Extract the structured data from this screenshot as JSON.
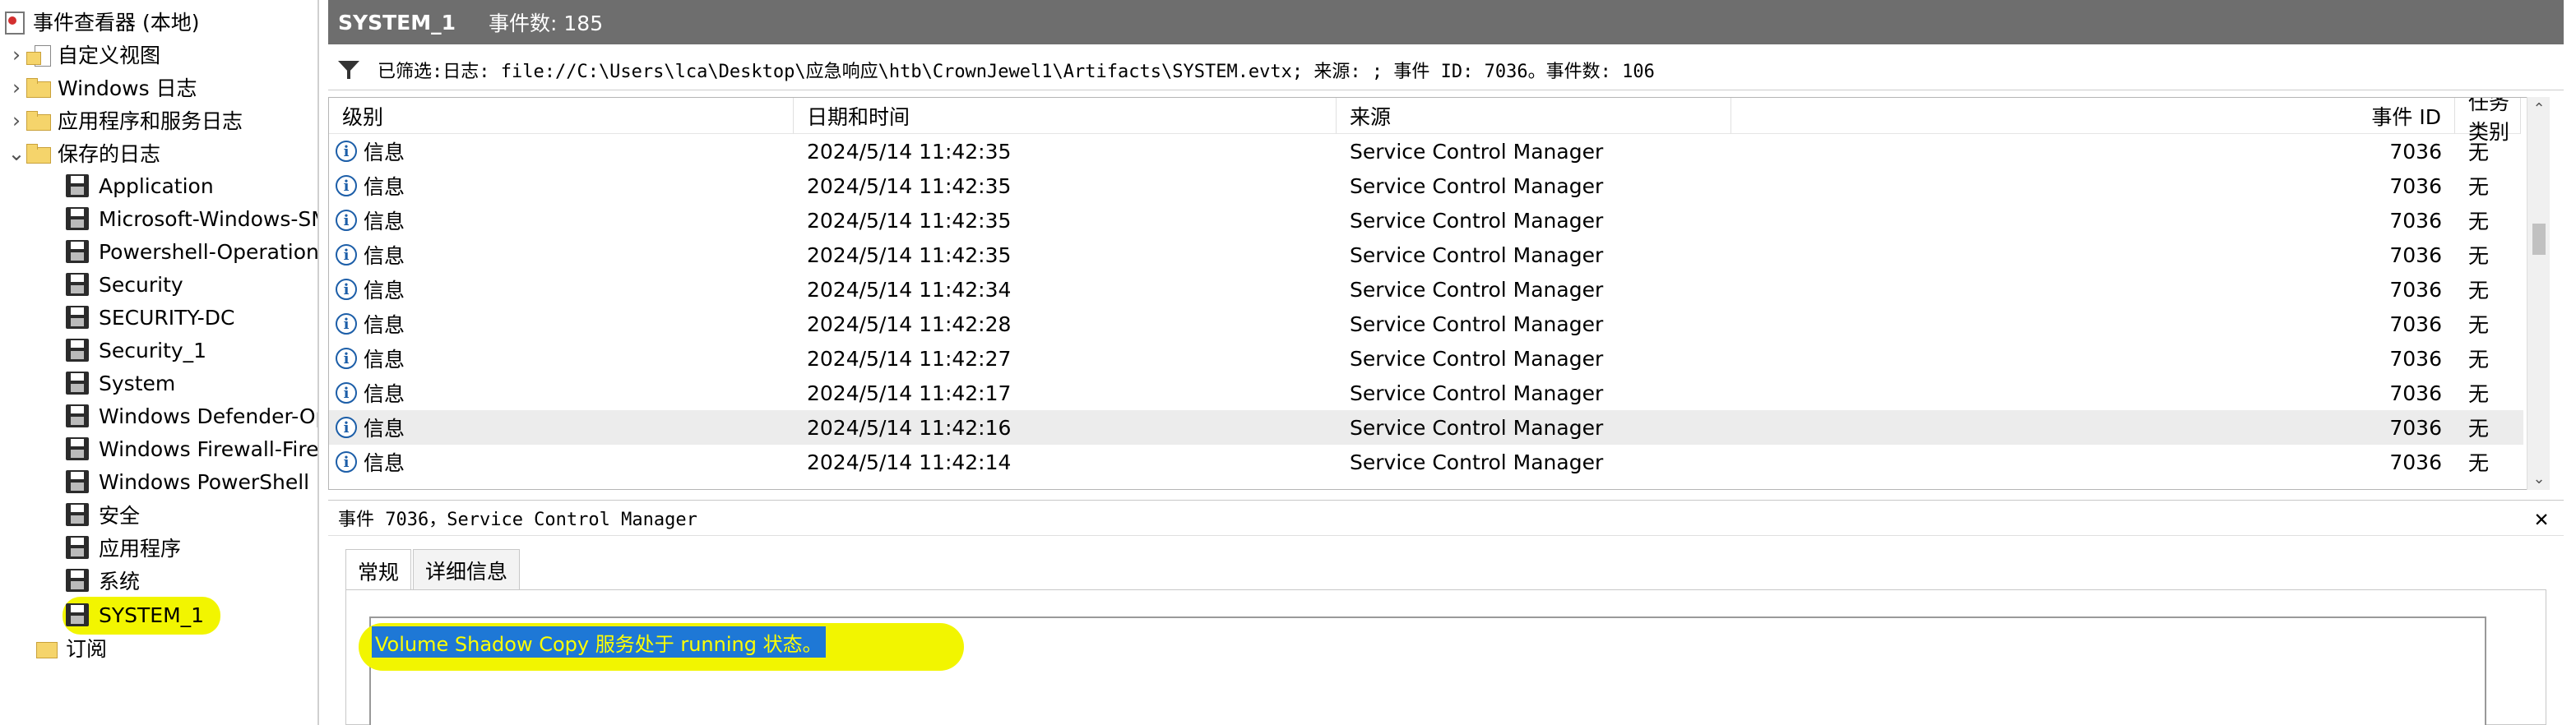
{
  "tree": {
    "root_label": "事件查看器 (本地)",
    "items": [
      {
        "label": "自定义视图",
        "kind": "folder"
      },
      {
        "label": "Windows 日志",
        "kind": "folder"
      },
      {
        "label": "应用程序和服务日志",
        "kind": "folder"
      },
      {
        "label": "保存的日志",
        "kind": "folder-open"
      }
    ],
    "saved_logs": [
      "Application",
      "Microsoft-Windows-SMBServer",
      "Powershell-Operational",
      "Security",
      "SECURITY-DC",
      "Security_1",
      "System",
      "Windows Defender-Operational",
      "Windows Firewall-Firewall",
      "Windows PowerShell",
      "安全",
      "应用程序",
      "系统",
      "SYSTEM_1"
    ],
    "subscriptions_label": "订阅",
    "selected": "SYSTEM_1"
  },
  "header": {
    "log_name": "SYSTEM_1",
    "event_count": "事件数: 185"
  },
  "filter": {
    "text": "已筛选:日志: file://C:\\Users\\lca\\Desktop\\应急响应\\htb\\CrownJewel1\\Artifacts\\SYSTEM.evtx; 来源: ; 事件 ID: 7036。事件数: 106"
  },
  "grid": {
    "columns": [
      "级别",
      "日期和时间",
      "来源",
      "事件 ID",
      "任务类别"
    ],
    "rows": [
      {
        "level": "信息",
        "datetime": "2024/5/14 11:42:35",
        "source": "Service Control Manager",
        "event_id": "7036",
        "task": "无"
      },
      {
        "level": "信息",
        "datetime": "2024/5/14 11:42:35",
        "source": "Service Control Manager",
        "event_id": "7036",
        "task": "无"
      },
      {
        "level": "信息",
        "datetime": "2024/5/14 11:42:35",
        "source": "Service Control Manager",
        "event_id": "7036",
        "task": "无"
      },
      {
        "level": "信息",
        "datetime": "2024/5/14 11:42:35",
        "source": "Service Control Manager",
        "event_id": "7036",
        "task": "无"
      },
      {
        "level": "信息",
        "datetime": "2024/5/14 11:42:34",
        "source": "Service Control Manager",
        "event_id": "7036",
        "task": "无"
      },
      {
        "level": "信息",
        "datetime": "2024/5/14 11:42:28",
        "source": "Service Control Manager",
        "event_id": "7036",
        "task": "无"
      },
      {
        "level": "信息",
        "datetime": "2024/5/14 11:42:27",
        "source": "Service Control Manager",
        "event_id": "7036",
        "task": "无"
      },
      {
        "level": "信息",
        "datetime": "2024/5/14 11:42:17",
        "source": "Service Control Manager",
        "event_id": "7036",
        "task": "无"
      },
      {
        "level": "信息",
        "datetime": "2024/5/14 11:42:16",
        "source": "Service Control Manager",
        "event_id": "7036",
        "task": "无"
      },
      {
        "level": "信息",
        "datetime": "2024/5/14 11:42:14",
        "source": "Service Control Manager",
        "event_id": "7036",
        "task": "无"
      }
    ],
    "selected_row": 8
  },
  "detail": {
    "title": "事件 7036，Service Control Manager",
    "tabs": [
      "常规",
      "详细信息"
    ],
    "active_tab": 0,
    "description": "Volume Shadow Copy 服务处于 running 状态。"
  },
  "colors": {
    "highlight": "#f2f500",
    "selection_blue": "#1e78d6",
    "titlebar": "#6e6e6e"
  }
}
